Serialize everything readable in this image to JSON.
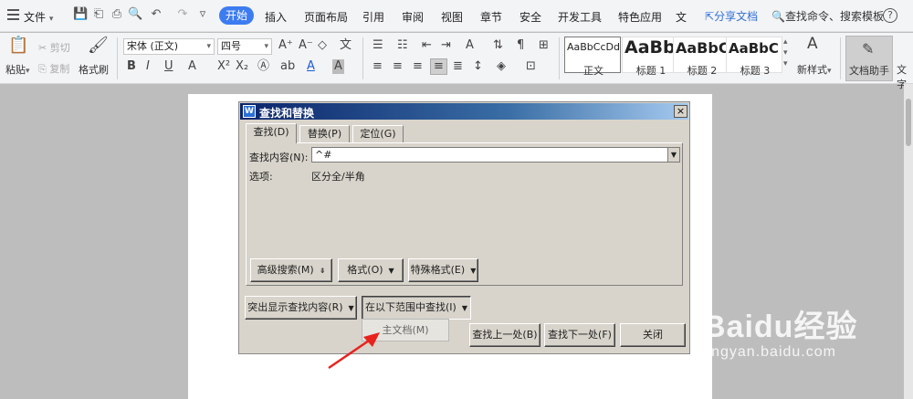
{
  "menubar": {
    "file_label": "文件",
    "tabs": [
      "开始",
      "插入",
      "页面布局",
      "引用",
      "审阅",
      "视图",
      "章节",
      "安全",
      "开发工具",
      "特色应用",
      "文"
    ],
    "share": "分享文档",
    "search_cmd": "查找命令、搜索模板",
    "help": "?"
  },
  "ribbon": {
    "paste": "粘贴",
    "cut": "剪切",
    "copy": "复制",
    "format_painter": "格式刷",
    "font_name": "宋体 (正文)",
    "font_size": "四号",
    "styles": [
      {
        "sample": "AaBbCcDd",
        "name": "正文"
      },
      {
        "sample": "AaBb",
        "name": "标题 1"
      },
      {
        "sample": "AaBbC",
        "name": "标题 2"
      },
      {
        "sample": "AaBbC",
        "name": "标题 3"
      }
    ],
    "new_style": "新样式",
    "doc_helper": "文档助手",
    "text_tool": "文字"
  },
  "dialog": {
    "title": "查找和替换",
    "tabs": [
      "查找(D)",
      "替换(P)",
      "定位(G)"
    ],
    "find_label": "查找内容(N):",
    "find_value": "^#",
    "options_label": "选项:",
    "options_value": "区分全/半角",
    "btn_advanced": "高级搜索(M)",
    "btn_format": "格式(O)",
    "btn_special": "特殊格式(E)",
    "btn_highlight": "突出显示查找内容(R)",
    "btn_find_in": "在以下范围中查找(I)",
    "menu_main_doc": "主文档(M)",
    "btn_find_prev": "查找上一处(B)",
    "btn_find_next": "查找下一处(F)",
    "btn_close": "关闭",
    "close_x": "×"
  },
  "watermark": {
    "logo": "Baidu经验",
    "url": "jingyan.baidu.com"
  }
}
